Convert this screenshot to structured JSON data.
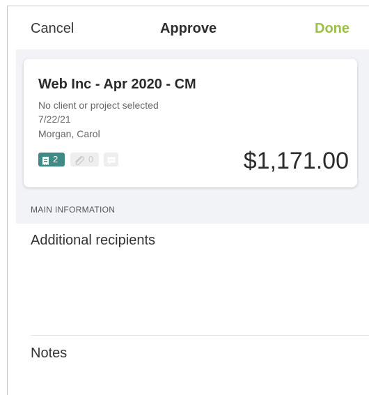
{
  "nav": {
    "cancel_label": "Cancel",
    "title": "Approve",
    "done_label": "Done",
    "done_color": "#9cc047"
  },
  "report": {
    "title": "Web Inc - Apr 2020 - CM",
    "client": "No client or project selected",
    "date": "7/22/21",
    "submitter": "Morgan, Carol",
    "amount": "$1,171.00",
    "badges": {
      "receipts_icon": "receipt-icon",
      "receipts_count": "2",
      "receipts_color": "#3f8a86",
      "attachments_icon": "paperclip-icon",
      "attachments_count": "0",
      "comments_icon": "comment-icon"
    }
  },
  "main": {
    "section_header": "MAIN INFORMATION",
    "recipients_label": "Additional recipients",
    "notes_label": "Notes"
  }
}
